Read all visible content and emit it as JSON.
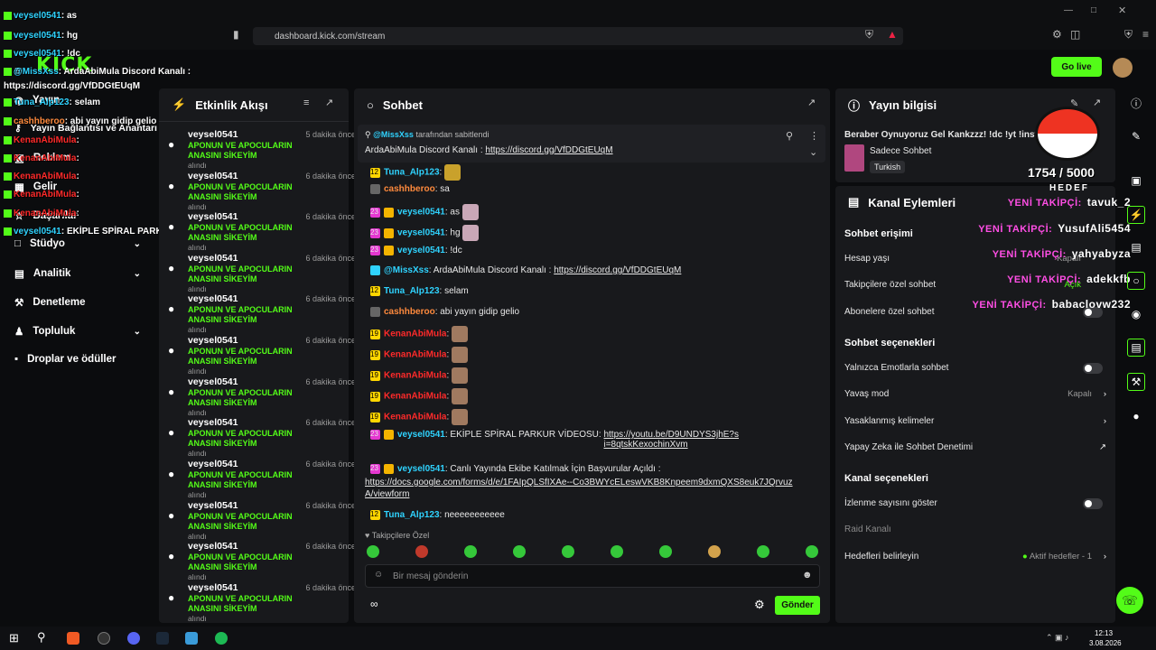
{
  "browser": {
    "url": "dashboard.kick.com/stream"
  },
  "header": {
    "go_live": "Go live",
    "logo": "KICK"
  },
  "overlay": {
    "chat": [
      {
        "user": "veysel0541",
        "text": "as"
      },
      {
        "user": "veysel0541",
        "text": "hg"
      },
      {
        "user": "veysel0541",
        "text": "!dc"
      },
      {
        "user": "@MissXss",
        "text": "ArdaAbiMula Discord Kanalı :"
      },
      {
        "user": "",
        "text": "https://discord.gg/VfDDGtEUqM"
      },
      {
        "user": "Tuna_Alp123",
        "text": "selam"
      },
      {
        "user": "cashhberoo",
        "text": "abi yayın gidip gelio"
      },
      {
        "user": "KenanAbiMula",
        "text": ""
      },
      {
        "user": "KenanAbiMula",
        "text": ""
      },
      {
        "user": "KenanAbiMula",
        "text": ""
      },
      {
        "user": "KenanAbiMula",
        "text": ""
      },
      {
        "user": "KenanAbiMula",
        "text": ""
      },
      {
        "user": "veysel0541",
        "text": "EKİPLE SPİRAL PARKUR VİDEOSU"
      }
    ],
    "goal_count": "1754 / 5000",
    "goal_label": "HEDEF",
    "followers_label": "YENİ TAKİPÇİ:",
    "followers": [
      "tavuk_2",
      "YusufAli5454",
      "yahyabyza",
      "adekkfb",
      "babaclovw232"
    ]
  },
  "sidebar": {
    "items": [
      {
        "label": "Yayın",
        "icon": "broadcast-icon"
      },
      {
        "label": "Yayın Bağlantısı ve Anahtarı",
        "icon": "key-icon"
      },
      {
        "label": "Reklam",
        "icon": "ad-icon"
      },
      {
        "label": "Gelir",
        "icon": "revenue-icon"
      },
      {
        "label": "Başarılar",
        "icon": "trophy-icon"
      },
      {
        "label": "Stüdyo",
        "icon": "studio-icon"
      },
      {
        "label": "Analitik",
        "icon": "chart-icon"
      },
      {
        "label": "Denetleme",
        "icon": "wrench-icon"
      },
      {
        "label": "Topluluk",
        "icon": "people-icon"
      },
      {
        "label": "Droplar ve ödüller",
        "icon": "gift-icon"
      }
    ]
  },
  "activity": {
    "title": "Etkinlik Akışı",
    "items": [
      {
        "user": "veysel0541",
        "time": "5 dakika önce",
        "msg": "APONUN VE APOCULARIN ANASINI SİKEYİM",
        "sub": "alındı"
      },
      {
        "user": "veysel0541",
        "time": "6 dakika önce",
        "msg": "APONUN VE APOCULARIN ANASINI SİKEYİM",
        "sub": "alındı"
      },
      {
        "user": "veysel0541",
        "time": "6 dakika önce",
        "msg": "APONUN VE APOCULARIN ANASINI SİKEYİM",
        "sub": "alındı"
      },
      {
        "user": "veysel0541",
        "time": "6 dakika önce",
        "msg": "APONUN VE APOCULARIN ANASINI SİKEYİM",
        "sub": "alındı"
      },
      {
        "user": "veysel0541",
        "time": "6 dakika önce",
        "msg": "APONUN VE APOCULARIN ANASINI SİKEYİM",
        "sub": "alındı"
      },
      {
        "user": "veysel0541",
        "time": "6 dakika önce",
        "msg": "APONUN VE APOCULARIN ANASINI SİKEYİM",
        "sub": "alındı"
      },
      {
        "user": "veysel0541",
        "time": "6 dakika önce",
        "msg": "APONUN VE APOCULARIN ANASINI SİKEYİM",
        "sub": "alındı"
      },
      {
        "user": "veysel0541",
        "time": "6 dakika önce",
        "msg": "APONUN VE APOCULARIN ANASINI SİKEYİM",
        "sub": "alındı"
      },
      {
        "user": "veysel0541",
        "time": "6 dakika önce",
        "msg": "APONUN VE APOCULARIN ANASINI SİKEYİM",
        "sub": "alındı"
      },
      {
        "user": "veysel0541",
        "time": "6 dakika önce",
        "msg": "APONUN VE APOCULARIN ANASINI SİKEYİM",
        "sub": "alındı"
      },
      {
        "user": "veysel0541",
        "time": "6 dakika önce",
        "msg": "APONUN VE APOCULARIN ANASINI SİKEYİM",
        "sub": "alındı"
      },
      {
        "user": "veysel0541",
        "time": "6 dakika önce",
        "msg": "APONUN VE APOCULARIN ANASINI SİKEYİM",
        "sub": "alındı"
      }
    ]
  },
  "chat": {
    "title": "Sohbet",
    "pinned": {
      "by": "@MissXss",
      "by_suffix": "tarafından sabitlendi",
      "text": "ArdaAbiMula Discord Kanalı :",
      "link": "https://discord.gg/VfDDGtEUqM"
    },
    "messages": [
      {
        "user": "Tuna_Alp123",
        "color": "#2fd3ff",
        "badge": "12",
        "text": ""
      },
      {
        "user": "cashhberoo",
        "color": "#ff8a3d",
        "text": "sa"
      },
      {
        "user": "veysel0541",
        "color": "#2fd3ff",
        "badge": "23",
        "text": "as"
      },
      {
        "user": "veysel0541",
        "color": "#2fd3ff",
        "badge": "23",
        "text": "hg"
      },
      {
        "user": "veysel0541",
        "color": "#2fd3ff",
        "badge": "23",
        "text": "!dc"
      },
      {
        "user": "@MissXss",
        "color": "#2fd3ff",
        "text": "ArdaAbiMula Discord Kanalı :",
        "link": "https://discord.gg/VfDDGtEUqM"
      },
      {
        "user": "Tuna_Alp123",
        "color": "#2fd3ff",
        "badge": "12",
        "text": "selam"
      },
      {
        "user": "cashhberoo",
        "color": "#ff8a3d",
        "text": "abi yayın gidip gelio"
      },
      {
        "user": "KenanAbiMula",
        "color": "#ff2a2a",
        "badge": "19",
        "text": ""
      },
      {
        "user": "KenanAbiMula",
        "color": "#ff2a2a",
        "badge": "19",
        "text": ""
      },
      {
        "user": "KenanAbiMula",
        "color": "#ff2a2a",
        "badge": "19",
        "text": ""
      },
      {
        "user": "KenanAbiMula",
        "color": "#ff2a2a",
        "badge": "19",
        "text": ""
      },
      {
        "user": "KenanAbiMula",
        "color": "#ff2a2a",
        "badge": "19",
        "text": ""
      },
      {
        "user": "veysel0541",
        "color": "#2fd3ff",
        "badge": "23",
        "text": "EKİPLE SPİRAL PARKUR VİDEOSU:",
        "link": "https://youtu.be/D9UNDYS3jhE?si=8qtskKexochinXvm"
      },
      {
        "user": "veysel0541",
        "color": "#2fd3ff",
        "badge": "23",
        "text": "Canlı Yayında Ekibe Katılmak İçin Başvurular Açıldı :",
        "link": "https://docs.google.com/forms/d/e/1FAIpQLSfIXAe--Co3BWYcELeswVKB8Knpeem9dxmQXS8euk7JQrvuzA/viewform"
      },
      {
        "user": "Tuna_Alp123",
        "color": "#2fd3ff",
        "badge": "12",
        "text": "neeeeeeeeeee"
      }
    ],
    "followers_only": "Takipçilere Özel",
    "input_placeholder": "Bir mesaj gönderin",
    "send": "Gönder"
  },
  "stream_info": {
    "title": "Yayın bilgisi",
    "stream_title": "Beraber Oynuyoruz Gel Kankzzz! !dc !yt !insta",
    "category": "Sadece Sohbet",
    "language": "Turkish"
  },
  "channel_actions": {
    "title": "Kanal Eylemleri",
    "chat_access": "Sohbet erişimi",
    "account_age": "Hesap yaşı",
    "account_age_val": "Kapalı",
    "followers_chat": "Takipçilere özel sohbet",
    "followers_chat_val": "Açık",
    "subs_chat": "Abonelere özel sohbet",
    "chat_options": "Sohbet seçenekleri",
    "emote_only": "Yalnızca Emotlarla sohbet",
    "slow_mode": "Yavaş mod",
    "slow_mode_val": "Kapalı",
    "banned_words": "Yasaklanmış kelimeler",
    "ai_mod": "Yapay Zeka ile Sohbet Denetimi",
    "channel_options": "Kanal seçenekleri",
    "show_viewers": "İzlenme sayısını göster",
    "raid": "Raid Kanalı",
    "goals": "Hedefleri belirleyin",
    "goals_val": "Aktif hedefler - 1"
  },
  "taskbar": {
    "time": "12:13",
    "date": "3.08.2026"
  },
  "colors": {
    "accent": "#53fc18",
    "panel": "#18191c",
    "bg": "#0b0c0e"
  }
}
